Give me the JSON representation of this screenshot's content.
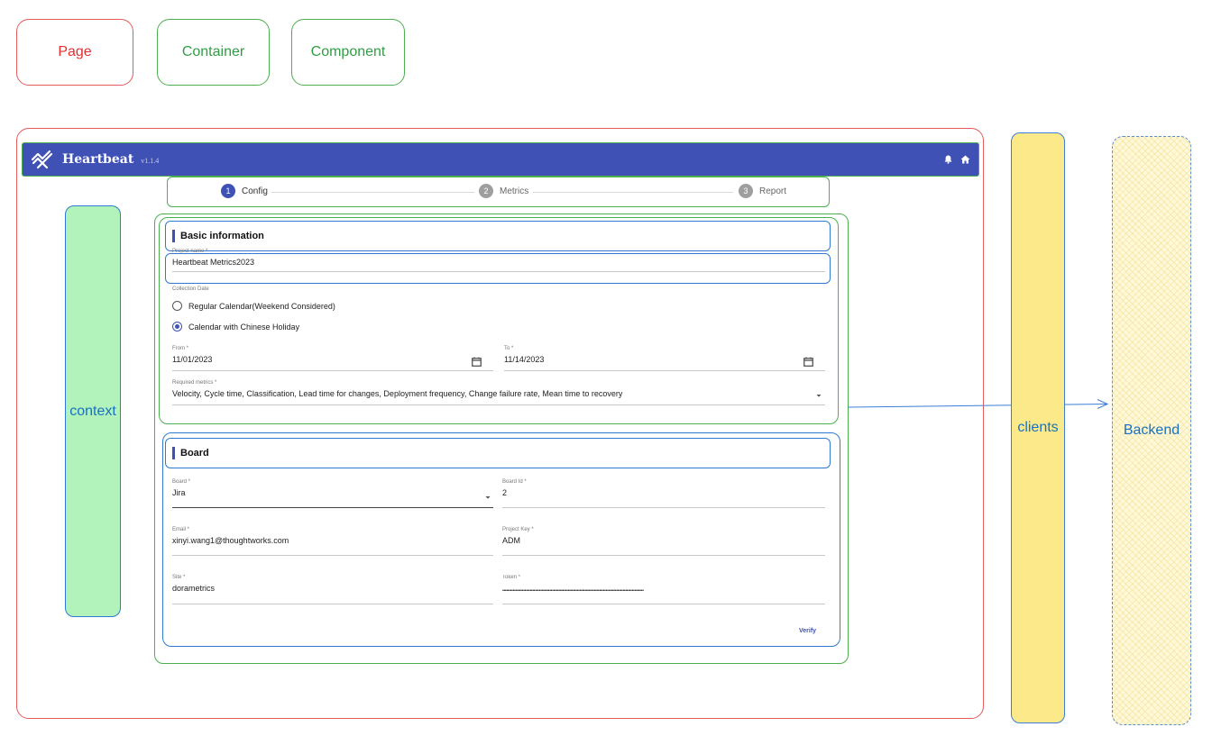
{
  "legend": {
    "page": "Page",
    "container": "Container",
    "component": "Component"
  },
  "header": {
    "brand": "Heartbeat",
    "version": "v1.1.4",
    "logo_icon": "heartbeat-logo-icon",
    "notification_icon": "bell-icon",
    "home_icon": "home-icon",
    "background_color": "#3f51b5"
  },
  "stepper": {
    "steps": [
      {
        "number": "1",
        "label": "Config",
        "active": true
      },
      {
        "number": "2",
        "label": "Metrics",
        "active": false
      },
      {
        "number": "3",
        "label": "Report",
        "active": false
      }
    ]
  },
  "basic_information": {
    "title": "Basic information",
    "project_name_label": "Project name *",
    "project_name_value": "Heartbeat Metrics2023",
    "collection_date_label": "Collection Date",
    "radio_options": [
      {
        "label": "Regular Calendar(Weekend Considered)",
        "checked": false
      },
      {
        "label": "Calendar with Chinese Holiday",
        "checked": true
      }
    ],
    "from_label": "From *",
    "from_value": "11/01/2023",
    "to_label": "To *",
    "to_value": "11/14/2023",
    "calendar_icon": "calendar-icon",
    "required_metrics_label": "Required metrics *",
    "required_metrics_value": "Velocity, Cycle time, Classification, Lead time for changes, Deployment frequency, Change failure rate, Mean time to recovery"
  },
  "board": {
    "title": "Board",
    "board_label": "Board *",
    "board_value": "Jira",
    "board_id_label": "Board Id *",
    "board_id_value": "2",
    "email_label": "Email *",
    "email_value": "xinyi.wang1@thoughtworks.com",
    "project_key_label": "Project Key *",
    "project_key_value": "ADM",
    "site_label": "Site *",
    "site_value": "dorametrics",
    "token_label": "Token *",
    "token_value": "••••••••••••••••••••••••••••••••••••••••••••••••••••••••••••••••••••••••••••••••••••••••••••••••••••••••••••",
    "verify_label": "Verify"
  },
  "annotations": {
    "context": "context",
    "clients": "clients",
    "backend": "Backend"
  },
  "colors": {
    "page_border": "#e55a5a",
    "container_border": "#4caf50",
    "component_border": "#2f7bd1",
    "context_fill": "#b2f2bb",
    "clients_fill": "#fce98a",
    "backend_fill": "#fff9d9"
  }
}
